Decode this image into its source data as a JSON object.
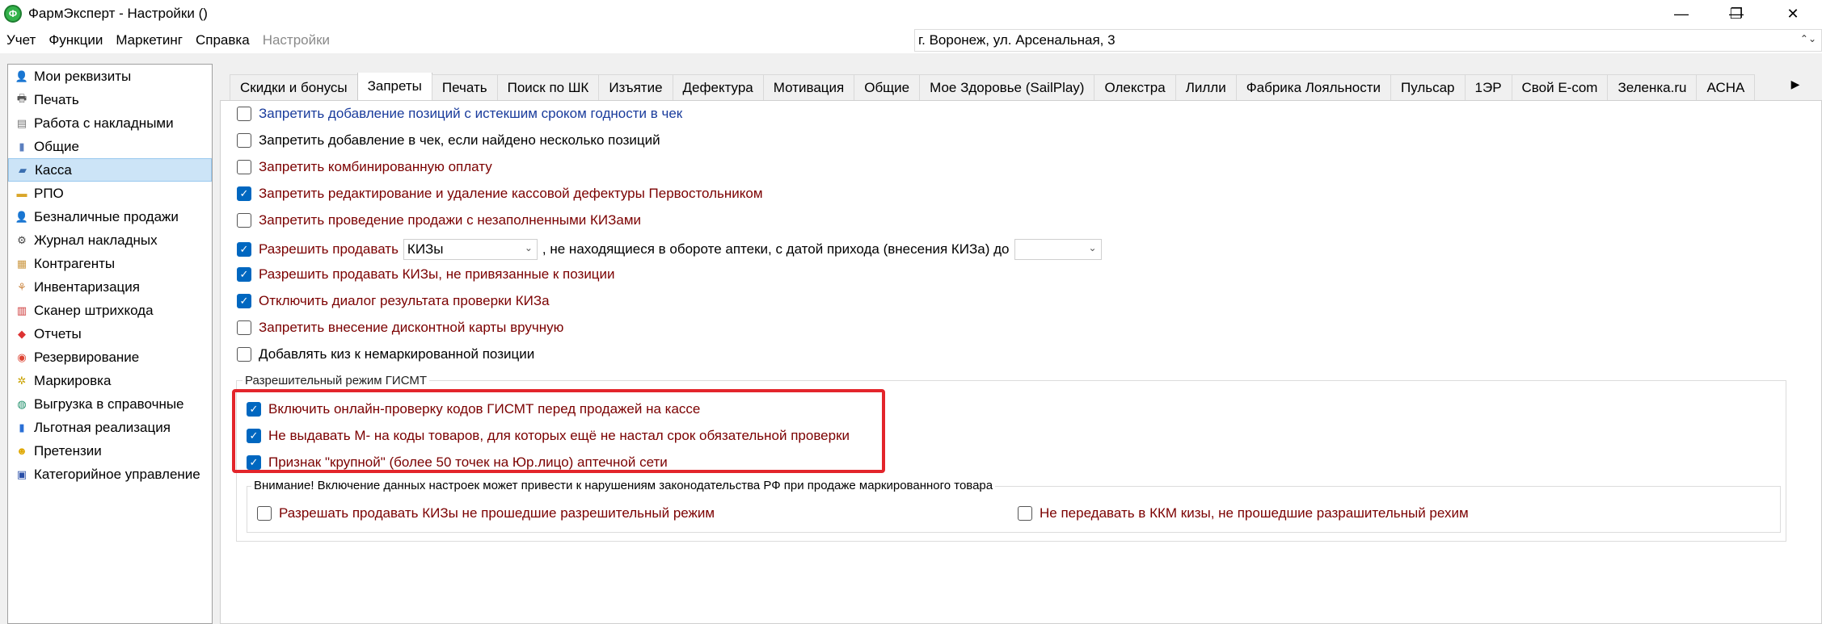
{
  "window": {
    "title": "ФармЭксперт - Настройки ()",
    "app_icon": "farmexpert-logo-icon",
    "minimize": "—",
    "maximize": "❐",
    "close": "✕"
  },
  "menu": {
    "items": [
      "Учет",
      "Функции",
      "Маркетинг",
      "Справка"
    ],
    "disabled_item": "Настройки",
    "pharmacy": "г. Воронеж, ул. Арсенальная, 3",
    "pharmacy_arrow": "⌃⌄"
  },
  "sidebar": {
    "items": [
      {
        "label": "Мои реквизиты",
        "icon": "user-icon"
      },
      {
        "label": "Печать",
        "icon": "printer-icon"
      },
      {
        "label": "Работа с накладными",
        "icon": "document-icon"
      },
      {
        "label": "Общие",
        "icon": "book-icon"
      },
      {
        "label": "Касса",
        "icon": "cash-register-icon",
        "selected": true
      },
      {
        "label": "РПО",
        "icon": "pill-icon"
      },
      {
        "label": "Безналичные продажи",
        "icon": "person-card-icon"
      },
      {
        "label": "Журнал накладных",
        "icon": "gear-icon"
      },
      {
        "label": "Контрагенты",
        "icon": "contacts-icon"
      },
      {
        "label": "Инвентаризация",
        "icon": "tree-icon"
      },
      {
        "label": "Сканер штрихкода",
        "icon": "barcode-icon"
      },
      {
        "label": "Отчеты",
        "icon": "report-icon"
      },
      {
        "label": "Резервирование",
        "icon": "reserve-icon"
      },
      {
        "label": "Маркировка",
        "icon": "marking-icon"
      },
      {
        "label": "Выгрузка в справочные",
        "icon": "upload-icon"
      },
      {
        "label": "Льготная реализация",
        "icon": "book-blue-icon"
      },
      {
        "label": "Претензии",
        "icon": "smiley-icon"
      },
      {
        "label": "Категорийное управление",
        "icon": "category-icon"
      }
    ]
  },
  "tabs": {
    "items": [
      "Скидки и бонусы",
      "Запреты",
      "Печать",
      "Поиск по ШК",
      "Изъятие",
      "Дефектура",
      "Мотивация",
      "Общие",
      "Мое Здоровье (SailPlay)",
      "Олекстра",
      "Лилли",
      "Фабрика Лояльности",
      "Пульсар",
      "1ЭР",
      "Свой E-com",
      "Зеленка.ru",
      "АСНА"
    ],
    "active_index": 1,
    "scroll_arrow": "▶"
  },
  "settings": {
    "opt1": "Запретить добавление позиций с истекшим сроком годности в чек",
    "opt2": "Запретить добавление в чек, если найдено несколько позиций",
    "opt3": "Запретить комбинированную оплату",
    "opt4": "Запретить редактирование и удаление кассовой дефектуры Первостольником",
    "opt5": "Запретить проведение продажи с незаполненными КИЗами",
    "opt6_prefix": "Разрешить продавать",
    "opt6_select": "КИЗы",
    "opt6_suffix": ", не находящиеся в обороте аптеки, с датой прихода (внесения КИЗа) до",
    "opt6_date": "",
    "opt7": "Разрешить продавать КИЗы, не привязанные к позиции",
    "opt8": "Отключить диалог результата проверки КИЗа",
    "opt9": "Запретить внесение дисконтной карты вручную",
    "opt10": "Добавлять киз к немаркированной позиции",
    "checked": {
      "opt1": false,
      "opt2": false,
      "opt3": false,
      "opt4": true,
      "opt5": false,
      "opt6": true,
      "opt7": true,
      "opt8": true,
      "opt9": false,
      "opt10": false
    },
    "dropdown_arrow": "⌄"
  },
  "gismt": {
    "group_title": "Разрешительный режим ГИСМТ",
    "opt1": "Включить онлайн-проверку кодов ГИСМТ перед продажей на кассе",
    "opt2": "Не выдавать М- на коды товаров, для которых ещё не настал срок обязательной проверки",
    "opt3": "Признак \"крупной\" (более 50 точек на Юр.лицо) аптечной сети",
    "warning_title": "Внимание! Включение данных настроек может привести к нарушениям законодательства РФ при продаже маркированного товара",
    "warn_opt1": "Разрешать продавать КИЗы не прошедшие разрешительный режим",
    "warn_opt2": "Не передавать в ККМ кизы, не прошедшие разрашительный рехим",
    "checked": {
      "opt1": true,
      "opt2": true,
      "opt3": true,
      "warn_opt1": false,
      "warn_opt2": false
    }
  },
  "colors": {
    "checkbox_checked": "#0067c0",
    "text_red": "#7b0000",
    "text_blue": "#1a3c9c",
    "highlight": "#e3252b",
    "selected_bg": "#cce4f7"
  }
}
